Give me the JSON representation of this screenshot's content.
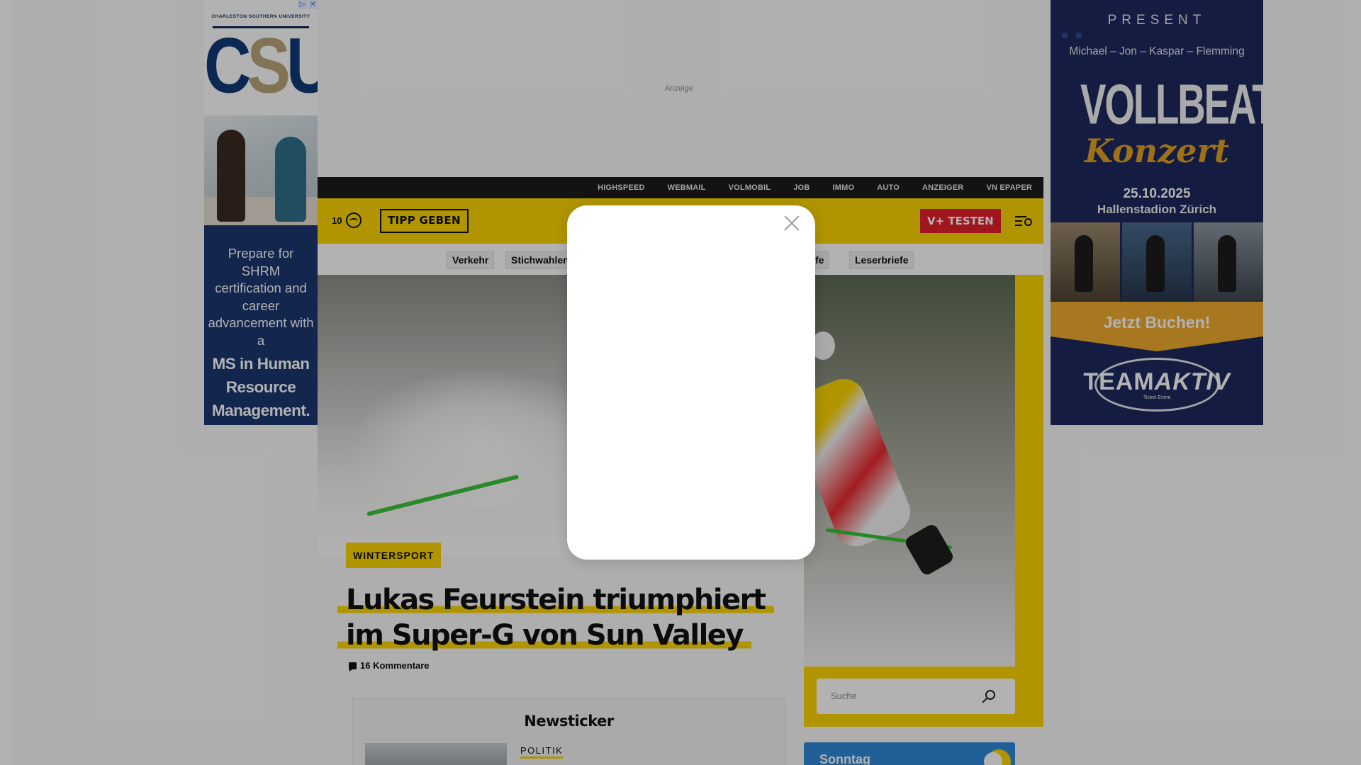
{
  "ads": {
    "top_label": "Anzeige",
    "left": {
      "university": "CHARLESTON SOUTHERN UNIVERSITY",
      "logo_c": "C",
      "logo_s": "S",
      "logo_u": "U",
      "copy": "Prepare for SHRM certification and career advancement with a",
      "emphasis": "MS in Human Resource Management."
    },
    "right": {
      "present": "PRESENT",
      "names": "Michael –  Jon –  Kaspar – Flemming",
      "band": "VOLLBEAT",
      "event": "Konzert",
      "date": "25.10.2025",
      "venue": "Hallenstadion Zürich",
      "cta": "Jetzt Buchen!",
      "brand_a": "TEAM",
      "brand_b": "AKTIV",
      "brand_sub": "Ticket Event"
    }
  },
  "topnav": [
    "HIGHSPEED",
    "WEBMAIL",
    "VOLMOBIL",
    "JOB",
    "IMMO",
    "AUTO",
    "ANZEIGER",
    "VN EPAPER"
  ],
  "header": {
    "temperature": "10",
    "tip_button": "TIPP GEBEN",
    "subscribe_button": "V+ TESTEN"
  },
  "subnav": {
    "chips": [
      "Verkehr",
      "Stichwahlen",
      "rufe",
      "Leserbriefe"
    ]
  },
  "article": {
    "category": "WINTERSPORT",
    "headline": "Lukas Feurstein triumphiert im Super-G von Sun Valley",
    "comments": "16 Kommentare"
  },
  "newsticker": {
    "title": "Newsticker",
    "first_category": "POLITIK"
  },
  "sidebar": {
    "search_placeholder": "Suche",
    "weather_day": "Sonntag"
  },
  "colors": {
    "brand_yellow": "#fdd600",
    "subscribe_red": "#e4202b",
    "topnav_bg": "#1c1c1c"
  }
}
